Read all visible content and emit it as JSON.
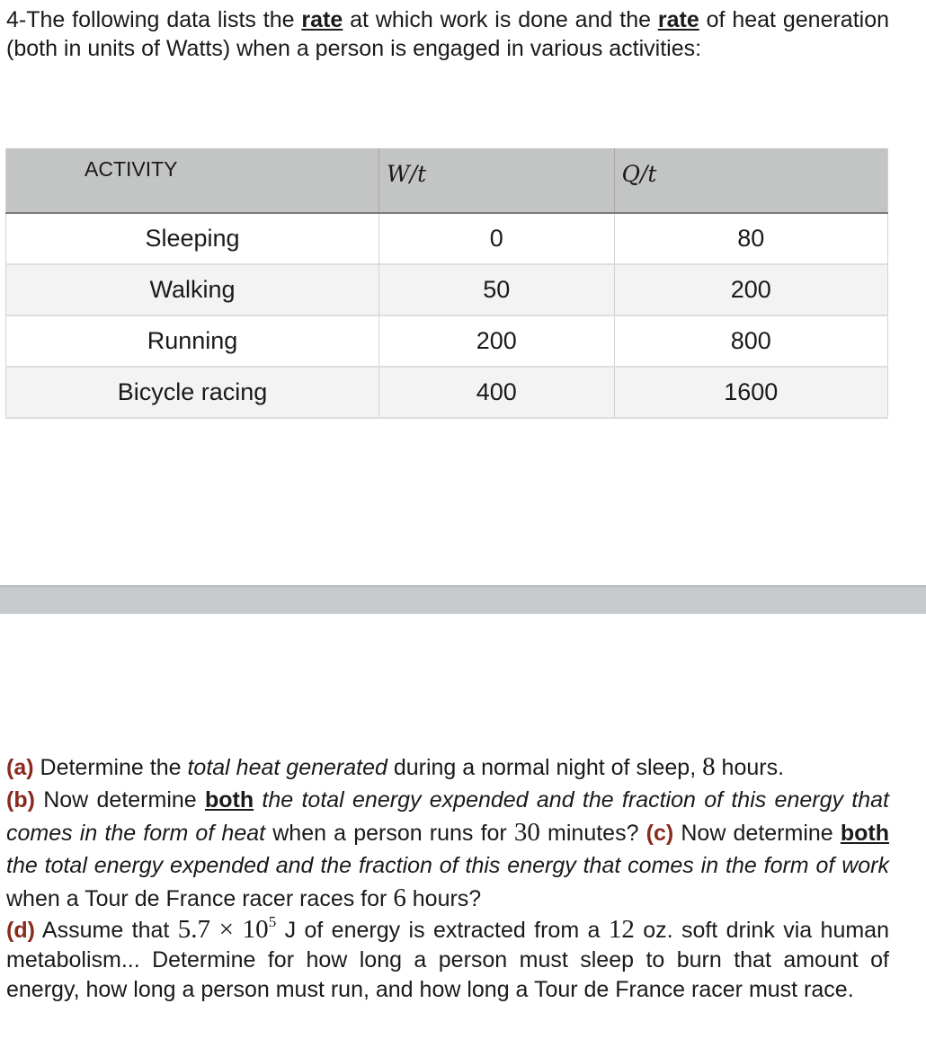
{
  "intro": {
    "prefix": "4-The following data lists the ",
    "rate1": "rate",
    "middle": " at which work is done and the ",
    "rate2": "rate",
    "suffix": " of heat generation (both in units of Watts) when a person is engaged in various activities:"
  },
  "table": {
    "headers": [
      "ACTIVITY",
      "W/t",
      "Q/t"
    ],
    "rows": [
      {
        "activity": "Sleeping",
        "w": "0",
        "q": "80"
      },
      {
        "activity": "Walking",
        "w": "50",
        "q": "200"
      },
      {
        "activity": "Running",
        "w": "200",
        "q": "800"
      },
      {
        "activity": "Bicycle racing",
        "w": "400",
        "q": "1600"
      }
    ]
  },
  "questions": {
    "a": {
      "label": "(a)",
      "t1": " Determine the ",
      "it1": "total heat generated",
      "t2": " during a normal night of sleep, ",
      "n": "8",
      "t3": " hours."
    },
    "b": {
      "label": "(b)",
      "t1": " Now determine ",
      "b1": "both",
      "it1": " the total energy expended and the fraction of this energy that comes in the form of heat",
      "t2": " when a person runs for ",
      "n": "30",
      "t3": " minutes? "
    },
    "c": {
      "label": "(c)",
      "t1": " Now determine ",
      "b1": "both ",
      "it1": "the total energy expended and the fraction of this energy that comes in the form of work",
      "t2": " when a Tour de France racer races for ",
      "n": "6",
      "t3": " hours?"
    },
    "d": {
      "label": "(d)",
      "t1": " Assume that ",
      "n1": "5.7 × 10",
      "exp": "5",
      "t2": " J of energy is extracted from a ",
      "n2": "12",
      "t3": " oz. soft drink via human metabolism... Determine for how long a person must sleep to burn that amount of energy, how long a person must run, and how long a Tour de France racer must race."
    }
  }
}
